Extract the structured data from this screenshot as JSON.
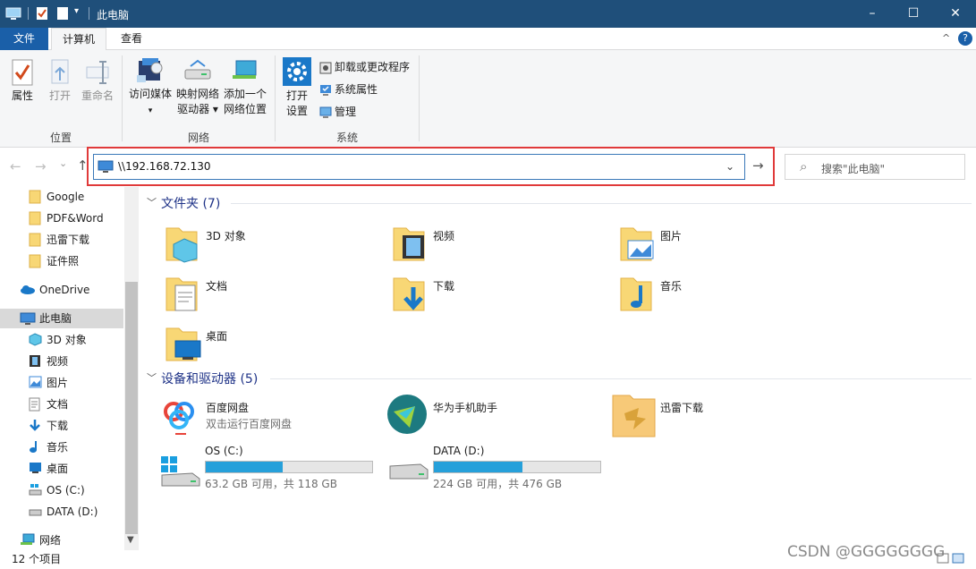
{
  "window": {
    "title": "此电脑",
    "minimize_glyph": "–",
    "maximize_glyph": "☐",
    "close_glyph": "✕"
  },
  "menu": {
    "file": "文件",
    "computer": "计算机",
    "view": "查看",
    "collapse_glyph": "^",
    "help_glyph": "?"
  },
  "ribbon": {
    "location_group": "位置",
    "network_group": "网络",
    "system_group": "系统",
    "properties": "属性",
    "open": "打开",
    "rename": "重命名",
    "access_media": "访问媒体",
    "map_drive_1": "映射网络",
    "map_drive_2": "驱动器 ▾",
    "add_location_1": "添加一个",
    "add_location_2": "网络位置",
    "open_settings_1": "打开",
    "open_settings_2": "设置",
    "uninstall": "卸载或更改程序",
    "system_properties": "系统属性",
    "manage": "管理"
  },
  "nav": {
    "back": "←",
    "forward": "→",
    "dropdown": "⌄",
    "up": "↑",
    "go": "→"
  },
  "address": {
    "value": "\\\\192.168.72.130",
    "dropdown_glyph": "⌄"
  },
  "search": {
    "placeholder": "搜索\"此电脑\"",
    "icon_glyph": "⌕"
  },
  "sidebar": {
    "items": [
      {
        "label": "Google",
        "icon": "folder-icon"
      },
      {
        "label": "PDF&Word",
        "icon": "folder-icon"
      },
      {
        "label": "迅雷下载",
        "icon": "folder-icon"
      },
      {
        "label": "证件照",
        "icon": "folder-icon"
      },
      {
        "label": "OneDrive",
        "icon": "cloud-icon"
      },
      {
        "label": "此电脑",
        "icon": "computer-icon"
      },
      {
        "label": "3D 对象",
        "icon": "cube-icon"
      },
      {
        "label": "视频",
        "icon": "film-icon"
      },
      {
        "label": "图片",
        "icon": "picture-icon"
      },
      {
        "label": "文档",
        "icon": "document-icon"
      },
      {
        "label": "下载",
        "icon": "download-icon"
      },
      {
        "label": "音乐",
        "icon": "music-icon"
      },
      {
        "label": "桌面",
        "icon": "desktop-icon"
      },
      {
        "label": "OS (C:)",
        "icon": "drive-icon"
      },
      {
        "label": "DATA (D:)",
        "icon": "drive-icon"
      },
      {
        "label": "网络",
        "icon": "network-icon"
      }
    ]
  },
  "folders": {
    "header": "文件夹 (7)",
    "items": [
      {
        "label": "3D 对象"
      },
      {
        "label": "视频"
      },
      {
        "label": "图片"
      },
      {
        "label": "文档"
      },
      {
        "label": "下载"
      },
      {
        "label": "音乐"
      },
      {
        "label": "桌面"
      }
    ]
  },
  "devices": {
    "header": "设备和驱动器 (5)",
    "baidu": {
      "name": "百度网盘",
      "sub": "双击运行百度网盘"
    },
    "huawei": {
      "name": "华为手机助手"
    },
    "xunlei": {
      "name": "迅雷下载"
    },
    "drive_c": {
      "name": "OS (C:)",
      "free": "63.2 GB 可用，共 118 GB",
      "used_fraction": 0.46
    },
    "drive_d": {
      "name": "DATA (D:)",
      "free": "224 GB 可用，共 476 GB",
      "used_fraction": 0.53
    }
  },
  "status": {
    "count": "12 个项目"
  },
  "watermark": "CSDN @GGGGGGGG",
  "colors": {
    "accent": "#1a5fa8",
    "bar": "#26a0da",
    "highlight": "#e03a3a"
  }
}
